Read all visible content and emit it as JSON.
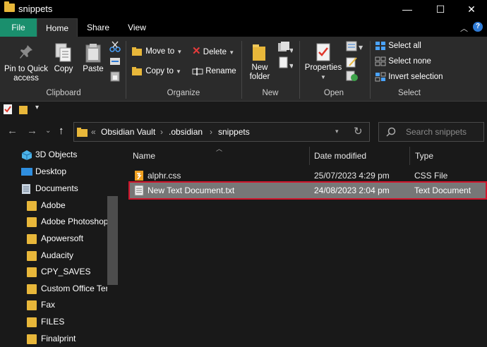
{
  "window": {
    "title": "snippets",
    "minimize": "—",
    "maximize": "☐",
    "close": "✕"
  },
  "tabs": {
    "file": "File",
    "home": "Home",
    "share": "Share",
    "view": "View"
  },
  "ribbon": {
    "clipboard": {
      "pin_label_1": "Pin to Quick",
      "pin_label_2": "access",
      "copy": "Copy",
      "paste": "Paste",
      "group": "Clipboard"
    },
    "organize": {
      "move_to": "Move to",
      "copy_to": "Copy to",
      "delete": "Delete",
      "rename": "Rename",
      "group": "Organize"
    },
    "new": {
      "new_folder_1": "New",
      "new_folder_2": "folder",
      "group": "New"
    },
    "open": {
      "properties": "Properties",
      "group": "Open"
    },
    "select": {
      "select_all": "Select all",
      "select_none": "Select none",
      "invert": "Invert selection",
      "group": "Select"
    }
  },
  "address": {
    "prefix": "«",
    "crumbs": [
      "Obsidian Vault",
      ".obsidian",
      "snippets"
    ],
    "separator": "›"
  },
  "search": {
    "placeholder": "Search snippets"
  },
  "nav": {
    "items": [
      "3D Objects",
      "Desktop",
      "Documents",
      "Adobe",
      "Adobe Photoshop",
      "Apowersoft",
      "Audacity",
      "CPY_SAVES",
      "Custom Office Ter",
      "Fax",
      "FILES",
      "Finalprint"
    ]
  },
  "columns": {
    "name": "Name",
    "date": "Date modified",
    "type": "Type"
  },
  "files": [
    {
      "name": "alphr.css",
      "date": "25/07/2023 4:29 pm",
      "type": "CSS File"
    },
    {
      "name": "New Text Document.txt",
      "date": "24/08/2023 2:04 pm",
      "type": "Text Document"
    }
  ],
  "colors": {
    "accent_file_tab": "#1a8f6d",
    "folder": "#e8b73a",
    "selection_outline": "#d0152c",
    "selection_fill": "#777777"
  }
}
